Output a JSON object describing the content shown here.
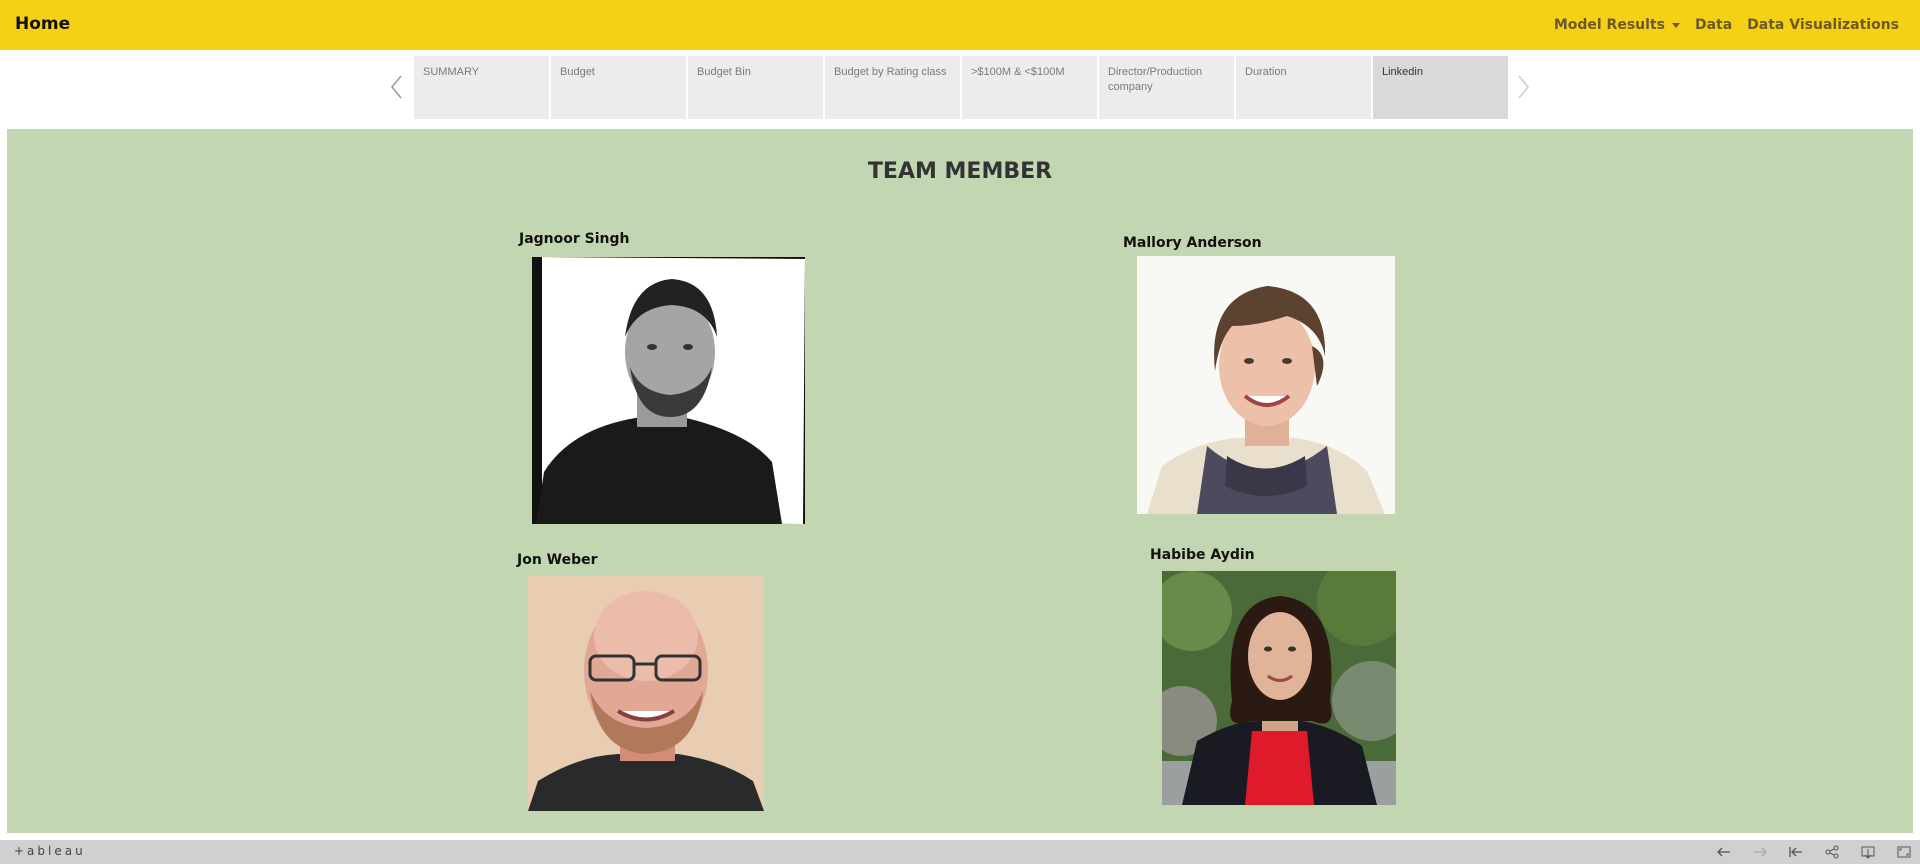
{
  "navbar": {
    "brand": "Home",
    "links": [
      "Model Results",
      "Data",
      "Data Visualizations"
    ],
    "background": "#f5d015"
  },
  "tabs": [
    "SUMMARY",
    "Budget",
    "Budget Bin",
    "Budget by Rating class",
    ">$100M & <$100M",
    "Director/Production company",
    "Duration",
    "Linkedin"
  ],
  "active_tab": "Linkedin",
  "dashboard": {
    "title": "TEAM MEMBER",
    "background": "#c2d6b1",
    "members": [
      {
        "name": "Jagnoor Singh",
        "photo": "grayscale portrait of bearded man in black polo"
      },
      {
        "name": "Mallory Anderson",
        "photo": "portrait of smiling woman with scarf"
      },
      {
        "name": "Jon Weber",
        "photo": "portrait of bald man with glasses"
      },
      {
        "name": "Habibe Aydin",
        "photo": "portrait of woman in red top outdoors"
      }
    ]
  },
  "footer": {
    "logo": "+ableau",
    "icons": [
      "undo-icon",
      "redo-icon",
      "revert-icon",
      "share-icon",
      "download-icon",
      "fullscreen-icon"
    ]
  }
}
